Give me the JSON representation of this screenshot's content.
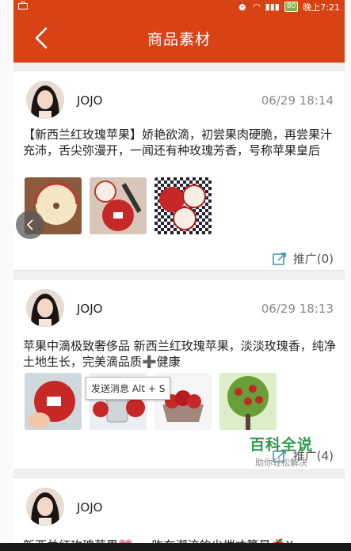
{
  "statusbar": {
    "right_text": "晚上7:21",
    "battery": "80"
  },
  "header": {
    "title": "商品素材"
  },
  "posts": [
    {
      "name": "JOJO",
      "time": "06/29 18:14",
      "text": "【新西兰红玫瑰苹果】娇艳欲滴，初尝果肉硬脆，再尝果汁充沛，舌尖弥漫开，一闻还有种玫瑰芳香，号称苹果皇后",
      "promo_label": "推广(0)"
    },
    {
      "name": "JOJO",
      "time": "06/29 18:13",
      "text": "苹果中滴极致奢侈品 新西兰红玫瑰苹果，淡淡玫瑰香，纯净土地生长，完美滴品质➕健康",
      "promo_label": "推广(4)"
    },
    {
      "name": "JOJO",
      "text": "新西兰红玫瑰苹果💗 ... 昨在潮流的尖端才算是🍎X"
    }
  ],
  "tooltip": {
    "text": "发送消息 Alt + S"
  },
  "watermark": {
    "title": "百科全说",
    "subtitle": "助你轻松解决"
  },
  "colors": {
    "header": "#d84315",
    "watermark": "#2e9a4a"
  },
  "icons": {
    "back": "chevron-left-icon",
    "promo": "share-edit-icon"
  }
}
